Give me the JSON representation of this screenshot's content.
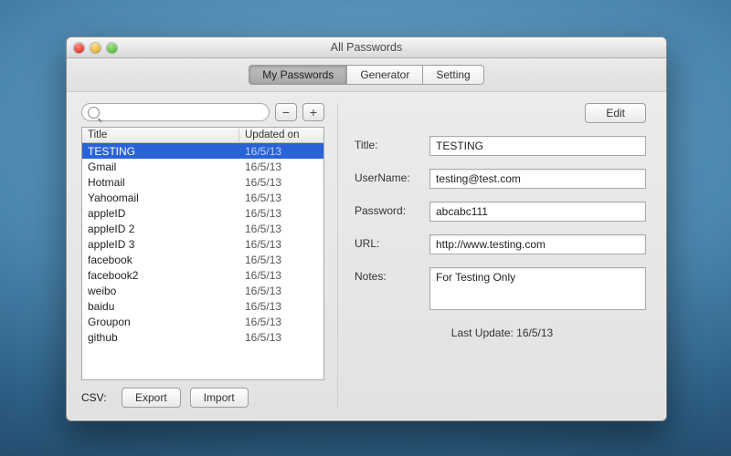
{
  "window": {
    "title": "All Passwords"
  },
  "tabs": [
    {
      "label": "My Passwords",
      "active": true
    },
    {
      "label": "Generator",
      "active": false
    },
    {
      "label": "Setting",
      "active": false
    }
  ],
  "search": {
    "value": "",
    "placeholder": ""
  },
  "buttons": {
    "remove": "−",
    "add": "+",
    "edit": "Edit",
    "export": "Export",
    "import": "Import"
  },
  "csv_label": "CSV:",
  "table": {
    "headers": {
      "title": "Title",
      "updated": "Updated on"
    },
    "rows": [
      {
        "title": "TESTING",
        "updated": "16/5/13",
        "selected": true
      },
      {
        "title": "Gmail",
        "updated": "16/5/13",
        "selected": false
      },
      {
        "title": "Hotmail",
        "updated": "16/5/13",
        "selected": false
      },
      {
        "title": "Yahoomail",
        "updated": "16/5/13",
        "selected": false
      },
      {
        "title": "appleID",
        "updated": "16/5/13",
        "selected": false
      },
      {
        "title": "appleID 2",
        "updated": "16/5/13",
        "selected": false
      },
      {
        "title": "appleID 3",
        "updated": "16/5/13",
        "selected": false
      },
      {
        "title": "facebook",
        "updated": "16/5/13",
        "selected": false
      },
      {
        "title": "facebook2",
        "updated": "16/5/13",
        "selected": false
      },
      {
        "title": "weibo",
        "updated": "16/5/13",
        "selected": false
      },
      {
        "title": "baidu",
        "updated": "16/5/13",
        "selected": false
      },
      {
        "title": "Groupon",
        "updated": "16/5/13",
        "selected": false
      },
      {
        "title": "github",
        "updated": "16/5/13",
        "selected": false
      }
    ]
  },
  "detail": {
    "labels": {
      "title": "Title:",
      "username": "UserName:",
      "password": "Password:",
      "url": "URL:",
      "notes": "Notes:"
    },
    "values": {
      "title": "TESTING",
      "username": "testing@test.com",
      "password": "abcabc111",
      "url": "http://www.testing.com",
      "notes": "For Testing Only"
    },
    "last_update_label": "Last Update: ",
    "last_update_value": "16/5/13"
  }
}
